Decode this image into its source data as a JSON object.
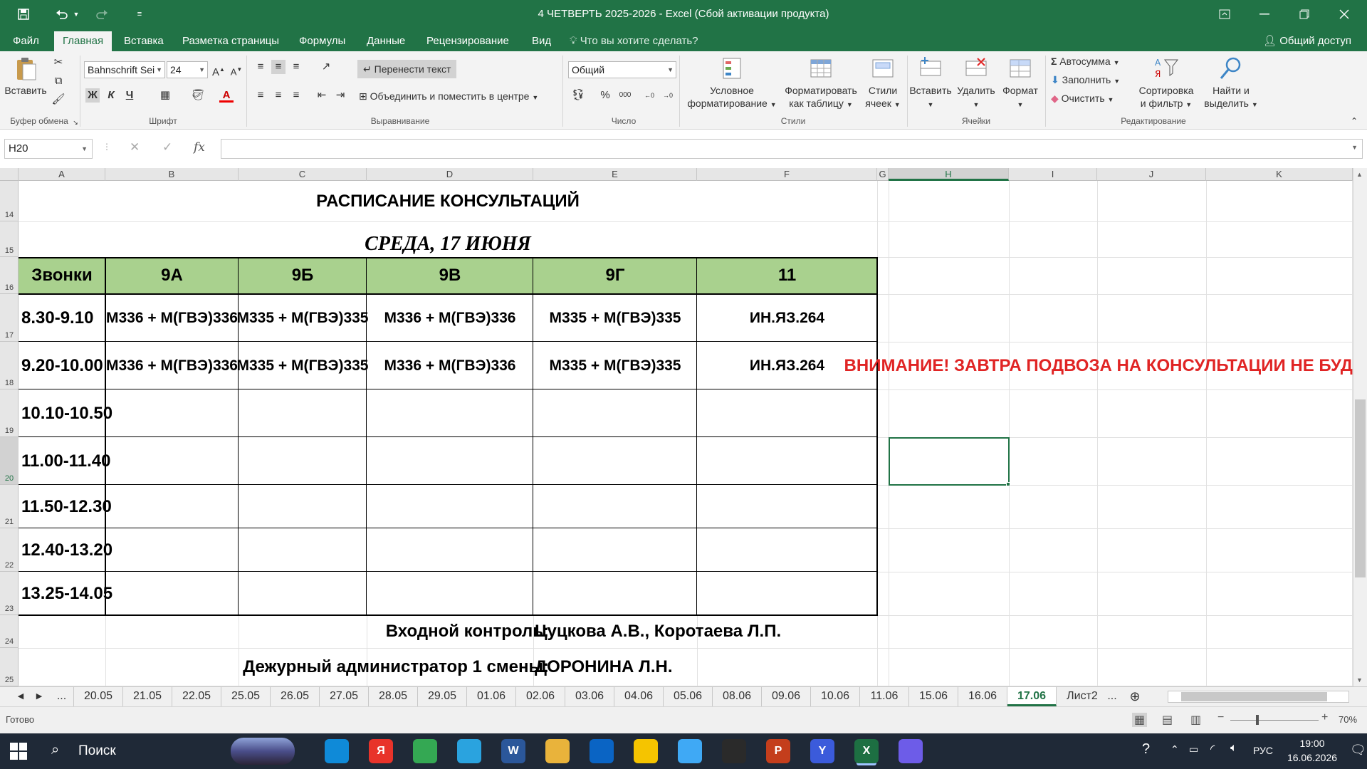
{
  "window": {
    "title": "4 ЧЕТВЕРТЬ 2025-2026 - Excel (Сбой активации продукта)",
    "colors": {
      "accent": "#217346",
      "table_header": "#a9d18e",
      "warning": "#e02424"
    }
  },
  "menu": {
    "tabs": [
      "Файл",
      "Главная",
      "Вставка",
      "Разметка страницы",
      "Формулы",
      "Данные",
      "Рецензирование",
      "Вид"
    ],
    "active_tab": "Главная",
    "tell_me": "Что вы хотите сделать?",
    "share": "Общий доступ"
  },
  "ribbon": {
    "clipboard": {
      "paste": "Вставить",
      "group": "Буфер обмена"
    },
    "font": {
      "name": "Bahnschrift Sei",
      "size": "24",
      "group": "Шрифт",
      "bold": "Ж",
      "italic": "К",
      "underline": "Ч"
    },
    "alignment": {
      "wrap": "Перенести текст",
      "merge": "Объединить и поместить в центре",
      "group": "Выравнивание"
    },
    "number": {
      "format": "Общий",
      "group": "Число"
    },
    "styles": {
      "conditional": [
        "Условное",
        "форматирование"
      ],
      "as_table": [
        "Форматировать",
        "как таблицу"
      ],
      "cell_styles": [
        "Стили",
        "ячеек"
      ],
      "group": "Стили"
    },
    "cells": {
      "insert": "Вставить",
      "delete": "Удалить",
      "format": "Формат",
      "group": "Ячейки"
    },
    "editing": {
      "autosum": "Автосумма",
      "fill": "Заполнить",
      "clear": "Очистить",
      "sort": [
        "Сортировка",
        "и фильтр"
      ],
      "find": [
        "Найти и",
        "выделить"
      ],
      "group": "Редактирование"
    }
  },
  "formula_bar": {
    "name_box": "H20",
    "value": ""
  },
  "columns": [
    "A",
    "B",
    "C",
    "D",
    "E",
    "F",
    "G",
    "H",
    "I",
    "J",
    "K"
  ],
  "selected_column": "H",
  "rows": [
    "14",
    "15",
    "16",
    "17",
    "18",
    "19",
    "20",
    "21",
    "22",
    "23",
    "24",
    "25"
  ],
  "selected_row": "20",
  "sheet": {
    "title": "РАСПИСАНИЕ КОНСУЛЬТАЦИЙ",
    "date": "СРЕДА, 17 ИЮНЯ",
    "headers": [
      "Звонки",
      "9А",
      "9Б",
      "9В",
      "9Г",
      "11"
    ],
    "schedule": [
      [
        "8.30-9.10",
        "М336 + М(ГВЭ)336",
        "М335 + М(ГВЭ)335",
        "М336 + М(ГВЭ)336",
        "М335 + М(ГВЭ)335",
        "ИН.ЯЗ.264"
      ],
      [
        "9.20-10.00",
        "М336 + М(ГВЭ)336",
        "М335 + М(ГВЭ)335",
        "М336 + М(ГВЭ)336",
        "М335 + М(ГВЭ)335",
        "ИН.ЯЗ.264"
      ],
      [
        "10.10-10.50",
        "",
        "",
        "",
        "",
        ""
      ],
      [
        "11.00-11.40",
        "",
        "",
        "",
        "",
        ""
      ],
      [
        "11.50-12.30",
        "",
        "",
        "",
        "",
        ""
      ],
      [
        "12.40-13.20",
        "",
        "",
        "",
        "",
        ""
      ],
      [
        "13.25-14.05",
        "",
        "",
        "",
        "",
        ""
      ]
    ],
    "entry_control_label": "Входной контроль:",
    "entry_control_value": "Цуцкова А.В., Коротаева Л.П.",
    "duty_label": "Дежурный администратор 1 смены:",
    "duty_value": "ДОРОНИНА Л.Н.",
    "notice": "ВНИМАНИЕ! ЗАВТРА ПОДВОЗА НА КОНСУЛЬТАЦИИ НЕ БУДЕТ!"
  },
  "sheet_tabs": {
    "tabs": [
      "20.05",
      "21.05",
      "22.05",
      "25.05",
      "26.05",
      "27.05",
      "28.05",
      "29.05",
      "01.06",
      "02.06",
      "03.06",
      "04.06",
      "05.06",
      "08.06",
      "09.06",
      "10.06",
      "11.06",
      "15.06",
      "16.06",
      "17.06",
      "Лист2"
    ],
    "active": "17.06",
    "ellipsis": "..."
  },
  "status": {
    "ready": "Готово",
    "zoom": "70%"
  },
  "taskbar": {
    "search": "Поиск",
    "lang": "РУС",
    "time": "19:00",
    "date": "16.06.2026",
    "apps": [
      {
        "icon": "edge-icon",
        "label": "",
        "color": "#0f8ad8"
      },
      {
        "icon": "yandex-icon",
        "label": "Я",
        "color": "#e8332a"
      },
      {
        "icon": "chrome-icon",
        "label": "",
        "color": "#34a853"
      },
      {
        "icon": "telegram-icon",
        "label": "",
        "color": "#2aa3df"
      },
      {
        "icon": "word-icon",
        "label": "W",
        "color": "#2b579a"
      },
      {
        "icon": "folder-icon",
        "label": "",
        "color": "#e9b33b"
      },
      {
        "icon": "outlook-icon",
        "label": "",
        "color": "#0a64c4"
      },
      {
        "icon": "market-icon",
        "label": "",
        "color": "#f5c400"
      },
      {
        "icon": "messenger-icon",
        "label": "",
        "color": "#3fa9f5"
      },
      {
        "icon": "bolt-icon",
        "label": "",
        "color": "#2a2a2a"
      },
      {
        "icon": "powerpoint-icon",
        "label": "P",
        "color": "#c43e1c"
      },
      {
        "icon": "yandex-browser-icon",
        "label": "Y",
        "color": "#3b5bdb"
      },
      {
        "icon": "excel-icon",
        "label": "X",
        "color": "#1d6f42"
      },
      {
        "icon": "chat-icon",
        "label": "",
        "color": "#6d5ce8"
      }
    ]
  }
}
